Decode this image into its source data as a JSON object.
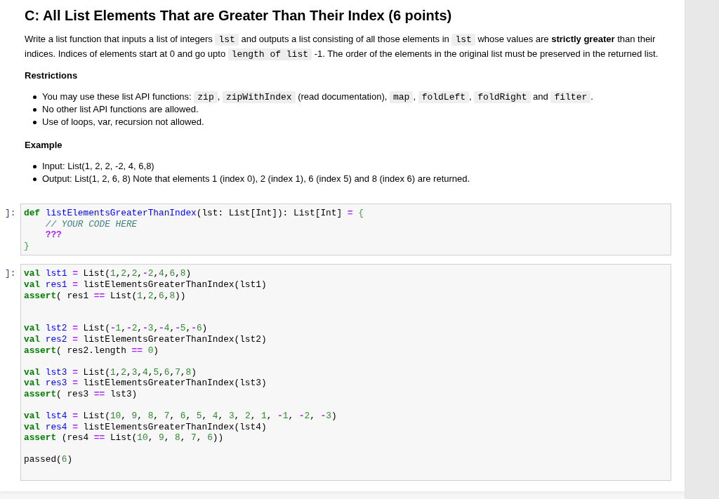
{
  "title": "C: All List Elements That are Greater Than Their Index (6 points)",
  "description": [
    {
      "kind": "text",
      "text": "Write a list function that inputs a list of integers "
    },
    {
      "kind": "code",
      "text": "lst"
    },
    {
      "kind": "text",
      "text": " and outputs a list consisting of all those elements in "
    },
    {
      "kind": "code",
      "text": "lst"
    },
    {
      "kind": "text",
      "text": " whose values are **strictly greater** than their indices. Indices of elements start at 0 and go upto "
    },
    {
      "kind": "code",
      "text": "length of list"
    },
    {
      "kind": "text",
      "text": " -1. The order of the elements in the original list must be preserved in the returned list."
    }
  ],
  "sections": [
    {
      "heading": "Restrictions",
      "items": [
        {
          "segments": [
            {
              "kind": "text",
              "text": "You may use these list API functions: "
            },
            {
              "kind": "code",
              "text": "zip"
            },
            {
              "kind": "text",
              "text": ", "
            },
            {
              "kind": "code",
              "text": "zipWithIndex"
            },
            {
              "kind": "text",
              "text": " (read documentation), "
            },
            {
              "kind": "code",
              "text": "map"
            },
            {
              "kind": "text",
              "text": ", "
            },
            {
              "kind": "code",
              "text": "foldLeft"
            },
            {
              "kind": "text",
              "text": ", "
            },
            {
              "kind": "code",
              "text": "foldRight"
            },
            {
              "kind": "text",
              "text": " and "
            },
            {
              "kind": "code",
              "text": "filter"
            },
            {
              "kind": "text",
              "text": "."
            }
          ]
        },
        {
          "segments": [
            {
              "kind": "text",
              "text": "No other list API functions are allowed."
            }
          ]
        },
        {
          "segments": [
            {
              "kind": "text",
              "text": "Use of loops, var, recursion not allowed."
            }
          ]
        }
      ]
    },
    {
      "heading": "Example",
      "items": [
        {
          "segments": [
            {
              "kind": "text",
              "text": "Input: List(1, 2, 2, -2, 4, 6,8)"
            }
          ]
        },
        {
          "segments": [
            {
              "kind": "text",
              "text": "Output: List(1, 2, 6, 8) Note that elements 1 (index 0), 2 (index 1), 6 (index 5) and 8 (index 6) are returned."
            }
          ]
        }
      ]
    }
  ],
  "code_cells": [
    {
      "prompt": "]:",
      "tokens": [
        {
          "kind": "keyword",
          "text": "def "
        },
        {
          "kind": "name",
          "text": "listElementsGreaterThanIndex"
        },
        {
          "kind": "plain",
          "text": "(lst: List[Int]): List[Int] "
        },
        {
          "kind": "operator",
          "text": "= "
        },
        {
          "kind": "brace",
          "text": "{\n    "
        },
        {
          "kind": "comment",
          "text": "// YOUR CODE HERE\n    "
        },
        {
          "kind": "placeholder",
          "text": "???\n"
        },
        {
          "kind": "brace",
          "text": "}"
        }
      ]
    },
    {
      "prompt": "]:",
      "tokens": [
        {
          "kind": "keyword",
          "text": "val "
        },
        {
          "kind": "name",
          "text": "lst1 "
        },
        {
          "kind": "operator",
          "text": "="
        },
        {
          "kind": "plain",
          "text": " List("
        },
        {
          "kind": "number",
          "text": "1"
        },
        {
          "kind": "plain",
          "text": ","
        },
        {
          "kind": "number",
          "text": "2"
        },
        {
          "kind": "plain",
          "text": ","
        },
        {
          "kind": "number",
          "text": "2"
        },
        {
          "kind": "plain",
          "text": ","
        },
        {
          "kind": "operator",
          "text": "-"
        },
        {
          "kind": "number",
          "text": "2"
        },
        {
          "kind": "plain",
          "text": ","
        },
        {
          "kind": "number",
          "text": "4"
        },
        {
          "kind": "plain",
          "text": ","
        },
        {
          "kind": "number",
          "text": "6"
        },
        {
          "kind": "plain",
          "text": ","
        },
        {
          "kind": "number",
          "text": "8"
        },
        {
          "kind": "plain",
          "text": ")\n"
        },
        {
          "kind": "keyword",
          "text": "val "
        },
        {
          "kind": "name",
          "text": "res1 "
        },
        {
          "kind": "operator",
          "text": "="
        },
        {
          "kind": "plain",
          "text": " listElementsGreaterThanIndex(lst1)\n"
        },
        {
          "kind": "keyword",
          "text": "assert"
        },
        {
          "kind": "plain",
          "text": "( res1 "
        },
        {
          "kind": "operator",
          "text": "=="
        },
        {
          "kind": "plain",
          "text": " List("
        },
        {
          "kind": "number",
          "text": "1"
        },
        {
          "kind": "plain",
          "text": ","
        },
        {
          "kind": "number",
          "text": "2"
        },
        {
          "kind": "plain",
          "text": ","
        },
        {
          "kind": "number",
          "text": "6"
        },
        {
          "kind": "plain",
          "text": ","
        },
        {
          "kind": "number",
          "text": "8"
        },
        {
          "kind": "plain",
          "text": "))\n\n\n"
        },
        {
          "kind": "keyword",
          "text": "val "
        },
        {
          "kind": "name",
          "text": "lst2 "
        },
        {
          "kind": "operator",
          "text": "="
        },
        {
          "kind": "plain",
          "text": " List("
        },
        {
          "kind": "operator",
          "text": "-"
        },
        {
          "kind": "number",
          "text": "1"
        },
        {
          "kind": "plain",
          "text": ","
        },
        {
          "kind": "operator",
          "text": "-"
        },
        {
          "kind": "number",
          "text": "2"
        },
        {
          "kind": "plain",
          "text": ","
        },
        {
          "kind": "operator",
          "text": "-"
        },
        {
          "kind": "number",
          "text": "3"
        },
        {
          "kind": "plain",
          "text": ","
        },
        {
          "kind": "operator",
          "text": "-"
        },
        {
          "kind": "number",
          "text": "4"
        },
        {
          "kind": "plain",
          "text": ","
        },
        {
          "kind": "operator",
          "text": "-"
        },
        {
          "kind": "number",
          "text": "5"
        },
        {
          "kind": "plain",
          "text": ","
        },
        {
          "kind": "operator",
          "text": "-"
        },
        {
          "kind": "number",
          "text": "6"
        },
        {
          "kind": "plain",
          "text": ")\n"
        },
        {
          "kind": "keyword",
          "text": "val "
        },
        {
          "kind": "name",
          "text": "res2 "
        },
        {
          "kind": "operator",
          "text": "="
        },
        {
          "kind": "plain",
          "text": " listElementsGreaterThanIndex(lst2)\n"
        },
        {
          "kind": "keyword",
          "text": "assert"
        },
        {
          "kind": "plain",
          "text": "( res2.length "
        },
        {
          "kind": "operator",
          "text": "== "
        },
        {
          "kind": "number",
          "text": "0"
        },
        {
          "kind": "plain",
          "text": ")\n\n"
        },
        {
          "kind": "keyword",
          "text": "val "
        },
        {
          "kind": "name",
          "text": "lst3 "
        },
        {
          "kind": "operator",
          "text": "="
        },
        {
          "kind": "plain",
          "text": " List("
        },
        {
          "kind": "number",
          "text": "1"
        },
        {
          "kind": "plain",
          "text": ","
        },
        {
          "kind": "number",
          "text": "2"
        },
        {
          "kind": "plain",
          "text": ","
        },
        {
          "kind": "number",
          "text": "3"
        },
        {
          "kind": "plain",
          "text": ","
        },
        {
          "kind": "number",
          "text": "4"
        },
        {
          "kind": "plain",
          "text": ","
        },
        {
          "kind": "number",
          "text": "5"
        },
        {
          "kind": "plain",
          "text": ","
        },
        {
          "kind": "number",
          "text": "6"
        },
        {
          "kind": "plain",
          "text": ","
        },
        {
          "kind": "number",
          "text": "7"
        },
        {
          "kind": "plain",
          "text": ","
        },
        {
          "kind": "number",
          "text": "8"
        },
        {
          "kind": "plain",
          "text": ")\n"
        },
        {
          "kind": "keyword",
          "text": "val "
        },
        {
          "kind": "name",
          "text": "res3 "
        },
        {
          "kind": "operator",
          "text": "="
        },
        {
          "kind": "plain",
          "text": " listElementsGreaterThanIndex(lst3)\n"
        },
        {
          "kind": "keyword",
          "text": "assert"
        },
        {
          "kind": "plain",
          "text": "( res3 "
        },
        {
          "kind": "operator",
          "text": "=="
        },
        {
          "kind": "plain",
          "text": " lst3)\n\n"
        },
        {
          "kind": "keyword",
          "text": "val "
        },
        {
          "kind": "name",
          "text": "lst4 "
        },
        {
          "kind": "operator",
          "text": "="
        },
        {
          "kind": "plain",
          "text": " List("
        },
        {
          "kind": "number",
          "text": "10"
        },
        {
          "kind": "plain",
          "text": ", "
        },
        {
          "kind": "number",
          "text": "9"
        },
        {
          "kind": "plain",
          "text": ", "
        },
        {
          "kind": "number",
          "text": "8"
        },
        {
          "kind": "plain",
          "text": ", "
        },
        {
          "kind": "number",
          "text": "7"
        },
        {
          "kind": "plain",
          "text": ", "
        },
        {
          "kind": "number",
          "text": "6"
        },
        {
          "kind": "plain",
          "text": ", "
        },
        {
          "kind": "number",
          "text": "5"
        },
        {
          "kind": "plain",
          "text": ", "
        },
        {
          "kind": "number",
          "text": "4"
        },
        {
          "kind": "plain",
          "text": ", "
        },
        {
          "kind": "number",
          "text": "3"
        },
        {
          "kind": "plain",
          "text": ", "
        },
        {
          "kind": "number",
          "text": "2"
        },
        {
          "kind": "plain",
          "text": ", "
        },
        {
          "kind": "number",
          "text": "1"
        },
        {
          "kind": "plain",
          "text": ", "
        },
        {
          "kind": "operator",
          "text": "-"
        },
        {
          "kind": "number",
          "text": "1"
        },
        {
          "kind": "plain",
          "text": ", "
        },
        {
          "kind": "operator",
          "text": "-"
        },
        {
          "kind": "number",
          "text": "2"
        },
        {
          "kind": "plain",
          "text": ", "
        },
        {
          "kind": "operator",
          "text": "-"
        },
        {
          "kind": "number",
          "text": "3"
        },
        {
          "kind": "plain",
          "text": ")\n"
        },
        {
          "kind": "keyword",
          "text": "val "
        },
        {
          "kind": "name",
          "text": "res4 "
        },
        {
          "kind": "operator",
          "text": "="
        },
        {
          "kind": "plain",
          "text": " listElementsGreaterThanIndex(lst4)\n"
        },
        {
          "kind": "keyword",
          "text": "assert"
        },
        {
          "kind": "plain",
          "text": " (res4 "
        },
        {
          "kind": "operator",
          "text": "=="
        },
        {
          "kind": "plain",
          "text": " List("
        },
        {
          "kind": "number",
          "text": "10"
        },
        {
          "kind": "plain",
          "text": ", "
        },
        {
          "kind": "number",
          "text": "9"
        },
        {
          "kind": "plain",
          "text": ", "
        },
        {
          "kind": "number",
          "text": "8"
        },
        {
          "kind": "plain",
          "text": ", "
        },
        {
          "kind": "number",
          "text": "7"
        },
        {
          "kind": "plain",
          "text": ", "
        },
        {
          "kind": "number",
          "text": "6"
        },
        {
          "kind": "plain",
          "text": "))\n\n"
        },
        {
          "kind": "plain",
          "text": "passed("
        },
        {
          "kind": "number",
          "text": "6"
        },
        {
          "kind": "plain",
          "text": ")\n"
        }
      ]
    }
  ]
}
